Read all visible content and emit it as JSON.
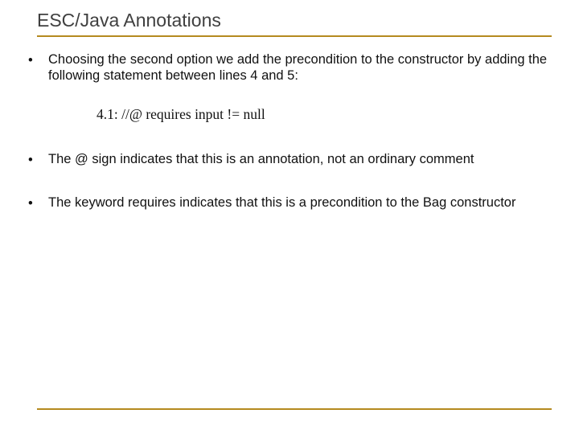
{
  "title": "ESC/Java Annotations",
  "bullets": [
    "Choosing the second option we add the precondition to the constructor by adding the following statement between lines 4 and 5:",
    "The @ sign indicates that this is an annotation, not an ordinary comment",
    "The keyword requires indicates that this is a precondition to the Bag constructor"
  ],
  "code_line": "4.1: //@ requires input != null"
}
